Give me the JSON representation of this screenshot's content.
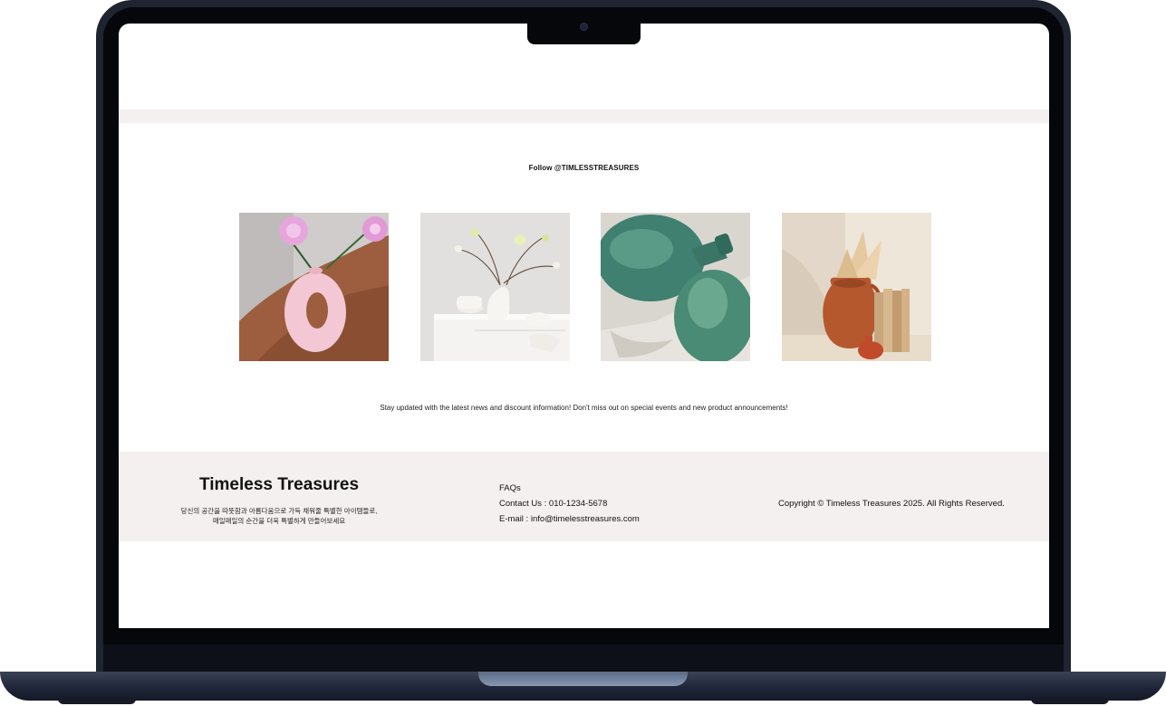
{
  "follow": {
    "label": "Follow @TIMLESSTREASURES"
  },
  "gallery": [
    {
      "name": "pink-donut-vase-with-flowers"
    },
    {
      "name": "white-ceramics-on-cabinet"
    },
    {
      "name": "green-glass-bottles"
    },
    {
      "name": "terracotta-jug-with-books"
    }
  ],
  "newsletter": {
    "text": "Stay updated with the latest news and discount information! Don't miss out on special events and new product announcements!"
  },
  "footer": {
    "brand": "Timeless Treasures",
    "desc_line1": "당신의 공간을 따뜻함과 아름다움으로 가득 채워줄 특별한 아이템들로,",
    "desc_line2": "매일매일의 순간을 더욱 특별하게 만들어보세요",
    "faq": "FAQs",
    "contact": "Contact Us : 010-1234-5678",
    "email": "E-mail : info@timelesstreasures.com",
    "copyright": "Copyright © Timeless Treasures 2025. All Rights Reserved."
  },
  "colors": {
    "band_bg": "#f4f0ef",
    "frame": "#1f2430"
  }
}
